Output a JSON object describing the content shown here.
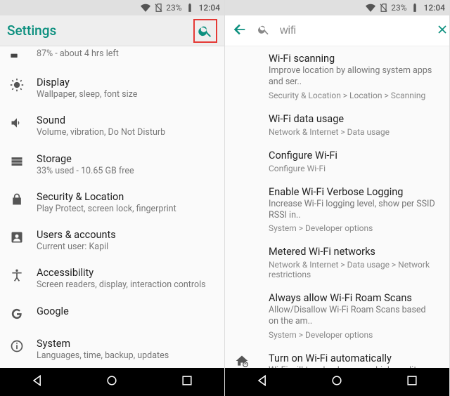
{
  "status": {
    "battery_pct": "23%",
    "time": "12:04"
  },
  "left": {
    "header_title": "Settings",
    "battery_partial_sub": "87% - about 4 hrs left",
    "items": [
      {
        "title": "Display",
        "sub": "Wallpaper, sleep, font size"
      },
      {
        "title": "Sound",
        "sub": "Volume, vibration, Do Not Disturb"
      },
      {
        "title": "Storage",
        "sub": "33% used - 10.65 GB free"
      },
      {
        "title": "Security & Location",
        "sub": "Play Protect, screen lock, fingerprint"
      },
      {
        "title": "Users & accounts",
        "sub": "Current user: Kapil"
      },
      {
        "title": "Accessibility",
        "sub": "Screen readers, display, interaction controls"
      },
      {
        "title": "Google"
      },
      {
        "title": "System",
        "sub": "Languages, time, backup, updates"
      }
    ]
  },
  "right": {
    "search_value": "wifi",
    "results": [
      {
        "title": "Wi-Fi scanning",
        "sub": "Improve location by allowing system apps and ser..",
        "bc": "Security & Location > Location > Scanning"
      },
      {
        "title": "Wi-Fi data usage",
        "bc": "Network & Internet > Data usage"
      },
      {
        "title": "Configure Wi-Fi",
        "bc": "Configure Wi-Fi"
      },
      {
        "title": "Enable Wi-Fi Verbose Logging",
        "sub": "Increase Wi-Fi logging level, show per SSID RSSI in..",
        "bc": "System > Developer options"
      },
      {
        "title": "Metered Wi-Fi networks",
        "bc": "Network & Internet > Data usage > Network restrictions"
      },
      {
        "title": "Always allow Wi-Fi Roam Scans",
        "sub": "Allow/Disallow Wi-Fi Roam Scans based on the am..",
        "bc": "System > Developer options"
      },
      {
        "title": "Turn on Wi-Fi automatically",
        "sub": "Wi-Fi will turn back on near high-quality saved net..",
        "has_icon": true
      }
    ]
  }
}
